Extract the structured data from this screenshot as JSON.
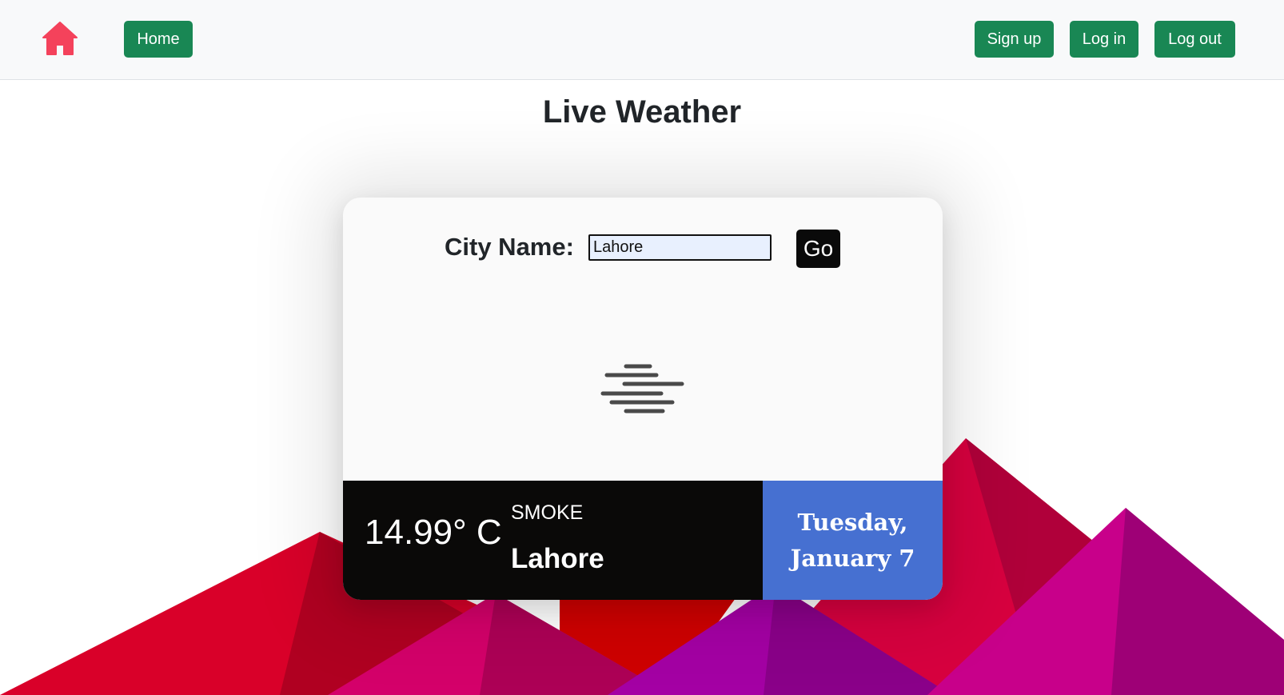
{
  "navbar": {
    "home_icon": "house-icon",
    "home_label": "Home",
    "signup_label": "Sign up",
    "login_label": "Log in",
    "logout_label": "Log out"
  },
  "page": {
    "title": "Live Weather"
  },
  "search": {
    "label": "City Name:",
    "value": "Lahore",
    "go_label": "Go"
  },
  "weather": {
    "icon": "haze-icon",
    "temperature": "14.99° C",
    "condition": "SMOKE",
    "city": "Lahore",
    "day": "Tuesday,",
    "date": "January 7"
  },
  "colors": {
    "brand_green": "#198754",
    "home_icon": "#f4425b",
    "date_panel": "#4670d1",
    "info_bar": "#0a0908"
  }
}
